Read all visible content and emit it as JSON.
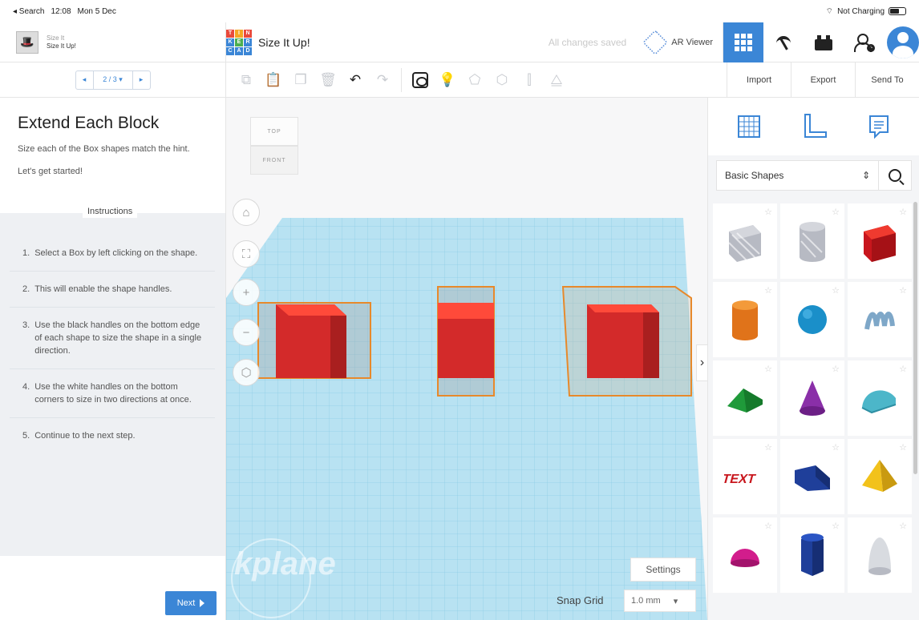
{
  "status_bar": {
    "back_app": "◂ Search",
    "time": "12:08",
    "date": "Mon 5 Dec",
    "charging": "Not Charging"
  },
  "header": {
    "lesson_label_small": "Size It",
    "lesson_label": "Size It Up!",
    "logo_letters": [
      "T",
      "I",
      "N",
      "K",
      "E",
      "R",
      "C",
      "A",
      "D"
    ],
    "project_title": "Size It Up!",
    "save_status": "All changes saved",
    "ar_viewer": "AR Viewer"
  },
  "lesson": {
    "step_counter": "2 / 3 ▾",
    "title": "Extend Each Block",
    "description": "Size each of the Box shapes match the hint.",
    "intro": "Let's get started!",
    "instructions_label": "Instructions",
    "steps": [
      {
        "num": "1.",
        "text": "Select a Box by left clicking on the shape."
      },
      {
        "num": "2.",
        "text": "This will enable the shape handles."
      },
      {
        "num": "3.",
        "text": "Use the black handles on the bottom edge of each shape to size the shape in a single direction."
      },
      {
        "num": "4.",
        "text": "Use the white handles on the bottom corners to size in two directions at once."
      },
      {
        "num": "5.",
        "text": "Continue to the next step."
      }
    ],
    "next_label": "Next"
  },
  "toolbar": {
    "import_label": "Import",
    "export_label": "Export",
    "send_to_label": "Send To"
  },
  "viewport": {
    "cube_top": "TOP",
    "cube_front": "FRONT",
    "workplane_mark": "kplane",
    "settings_label": "Settings",
    "snap_grid_label": "Snap Grid",
    "snap_grid_value": "1.0 mm"
  },
  "shapes_panel": {
    "category": "Basic Shapes",
    "shapes": [
      "Box Hole",
      "Cylinder Hole",
      "Box",
      "Cylinder",
      "Sphere",
      "Scribble",
      "Roof",
      "Cone",
      "Round Roof",
      "Text",
      "Wedge",
      "Pyramid",
      "Half Sphere",
      "Polygon",
      "Paraboloid"
    ]
  },
  "colors": {
    "accent": "#3b86d6",
    "box_red": "#d32a2a",
    "workplane": "#a9dcef",
    "orange_outline": "#e7892b"
  }
}
